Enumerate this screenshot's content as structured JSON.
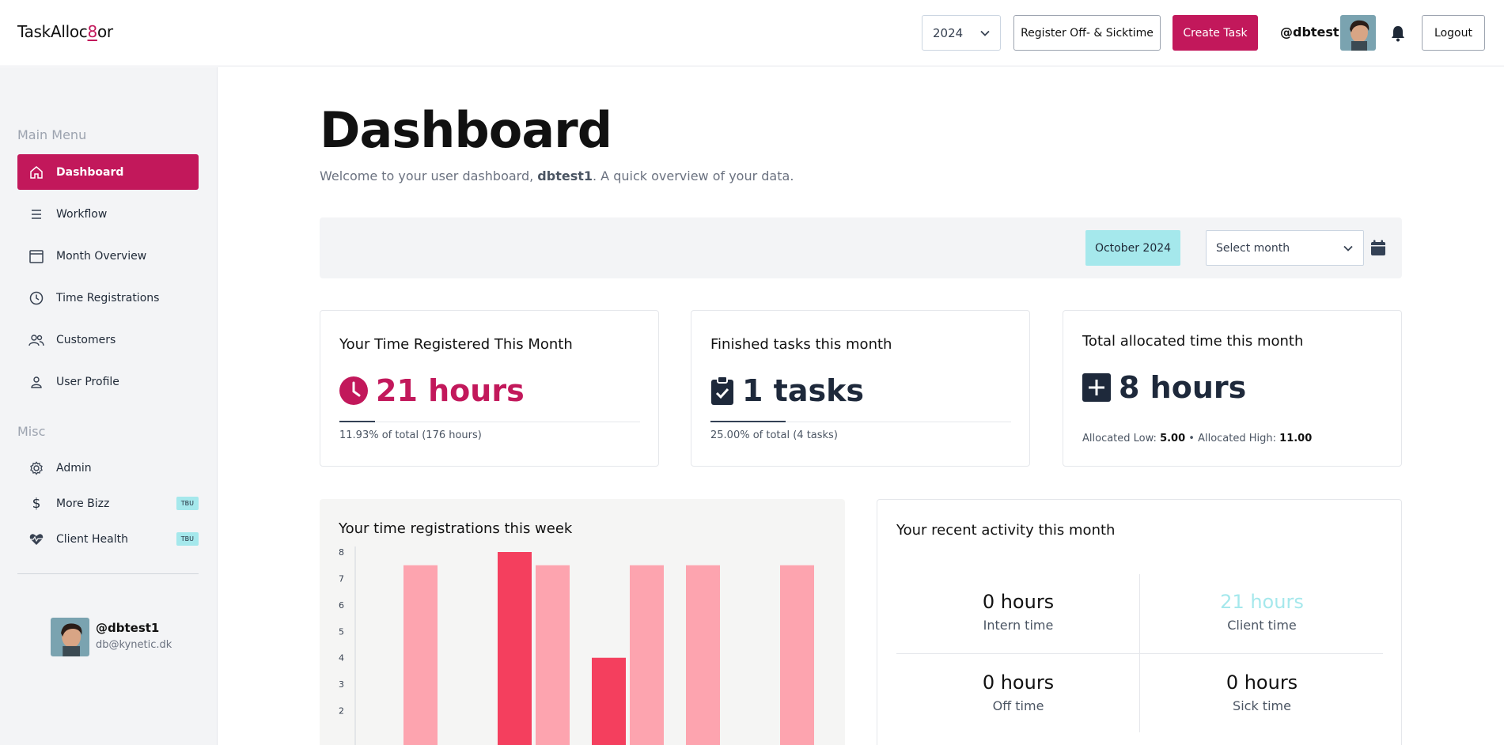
{
  "header": {
    "logo_prefix": "TaskAlloc",
    "logo_digit": "8",
    "logo_suffix": "or",
    "year": "2024",
    "register_label": "Register Off- & Sicktime",
    "create_label": "Create Task",
    "handle": "@dbtest1",
    "logout_label": "Logout"
  },
  "sidebar": {
    "main_menu_label": "Main Menu",
    "main_items": [
      {
        "label": "Dashboard",
        "icon": "home-icon"
      },
      {
        "label": "Workflow",
        "icon": "list-icon"
      },
      {
        "label": "Month Overview",
        "icon": "calendar-icon"
      },
      {
        "label": "Time Registrations",
        "icon": "clock-icon"
      },
      {
        "label": "Customers",
        "icon": "users-icon"
      },
      {
        "label": "User Profile",
        "icon": "user-icon"
      }
    ],
    "misc_label": "Misc",
    "misc_items": [
      {
        "label": "Admin",
        "icon": "gear-icon"
      },
      {
        "label": "More Bizz",
        "icon": "dollar-icon",
        "badge": "TBU"
      },
      {
        "label": "Client Health",
        "icon": "heart-pulse-icon",
        "badge": "TBU"
      }
    ],
    "user": {
      "handle": "@dbtest1",
      "email": "db@kynetic.dk"
    }
  },
  "main": {
    "title": "Dashboard",
    "welcome_prefix": "Welcome to your user dashboard, ",
    "welcome_user": "dbtest1",
    "welcome_suffix": ". A quick overview of your data.",
    "month_chip": "October 2024",
    "month_select_placeholder": "Select month"
  },
  "cards": {
    "time": {
      "title": "Your Time Registered This Month",
      "value": "21 hours",
      "sub": "11.93% of total (176 hours)",
      "progress": 0.1193,
      "color": "#c2185b"
    },
    "tasks": {
      "title": "Finished tasks this month",
      "value": "1 tasks",
      "sub": "25.00% of total (4 tasks)",
      "progress": 0.25,
      "color": "#1e293b"
    },
    "allocated": {
      "title": "Total allocated time this month",
      "value": "8 hours",
      "low_label": "Allocated Low: ",
      "low_value": "5.00",
      "separator": " • ",
      "high_label": "Allocated High: ",
      "high_value": "11.00"
    }
  },
  "chart_panel": {
    "title": "Your time registrations this week"
  },
  "chart_data": {
    "type": "bar",
    "ylim": [
      1,
      8
    ],
    "yticks": [
      "8",
      "7",
      "6",
      "5",
      "4",
      "3",
      "2"
    ],
    "bars": [
      {
        "group": 0,
        "value": 7.5,
        "color": "#fda4af"
      },
      {
        "group": 1,
        "value": 8,
        "color": "#f43f5e"
      },
      {
        "group": 1,
        "value": 7.5,
        "color": "#fda4af"
      },
      {
        "group": 2,
        "value": 4,
        "color": "#f43f5e"
      },
      {
        "group": 2,
        "value": 7.5,
        "color": "#fda4af"
      },
      {
        "group": 3,
        "value": 7.5,
        "color": "#fda4af"
      },
      {
        "group": 4,
        "value": 7.5,
        "color": "#fda4af"
      }
    ]
  },
  "activity": {
    "title": "Your recent activity this month",
    "items": [
      {
        "value": "0 hours",
        "label": "Intern time",
        "color": "#111111"
      },
      {
        "value": "21 hours",
        "label": "Client time",
        "color": "#a5e8ec"
      },
      {
        "value": "0 hours",
        "label": "Off time",
        "color": "#111111"
      },
      {
        "value": "0 hours",
        "label": "Sick time",
        "color": "#111111"
      }
    ]
  }
}
